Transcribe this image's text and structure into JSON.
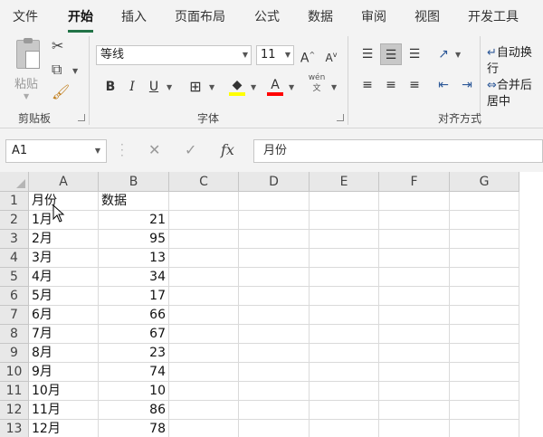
{
  "tabs": [
    "文件",
    "开始",
    "插入",
    "页面布局",
    "公式",
    "数据",
    "审阅",
    "视图",
    "开发工具"
  ],
  "ribbon": {
    "clipboard": {
      "paste_label": "粘贴",
      "group_label": "剪贴板"
    },
    "font": {
      "font_name": "等线",
      "font_size": "11",
      "bold": "B",
      "italic": "I",
      "underline": "U",
      "group_label": "字体",
      "grow": "A",
      "shrink": "A",
      "phonetic_top": "wén",
      "phonetic_bottom": "文"
    },
    "alignment": {
      "group_label": "对齐方式",
      "wrap_text": "自动换行",
      "merge_center": "合并后居中"
    },
    "colors": {
      "accent": "#217346",
      "highlight": "#ffff00",
      "font_color": "#ff0000"
    }
  },
  "formula_bar": {
    "name_box": "A1",
    "fx": "fx",
    "formula": "月份"
  },
  "sheet": {
    "columns": [
      "A",
      "B",
      "C",
      "D",
      "E",
      "F",
      "G"
    ],
    "rows": [
      {
        "n": "1",
        "a": "月份",
        "b": "数据"
      },
      {
        "n": "2",
        "a": "1月",
        "b": "21"
      },
      {
        "n": "3",
        "a": "2月",
        "b": "95"
      },
      {
        "n": "4",
        "a": "3月",
        "b": "13"
      },
      {
        "n": "5",
        "a": "4月",
        "b": "34"
      },
      {
        "n": "6",
        "a": "5月",
        "b": "17"
      },
      {
        "n": "7",
        "a": "6月",
        "b": "66"
      },
      {
        "n": "8",
        "a": "7月",
        "b": "67"
      },
      {
        "n": "9",
        "a": "8月",
        "b": "23"
      },
      {
        "n": "10",
        "a": "9月",
        "b": "74"
      },
      {
        "n": "11",
        "a": "10月",
        "b": "10"
      },
      {
        "n": "12",
        "a": "11月",
        "b": "86"
      },
      {
        "n": "13",
        "a": "12月",
        "b": "78"
      }
    ]
  }
}
